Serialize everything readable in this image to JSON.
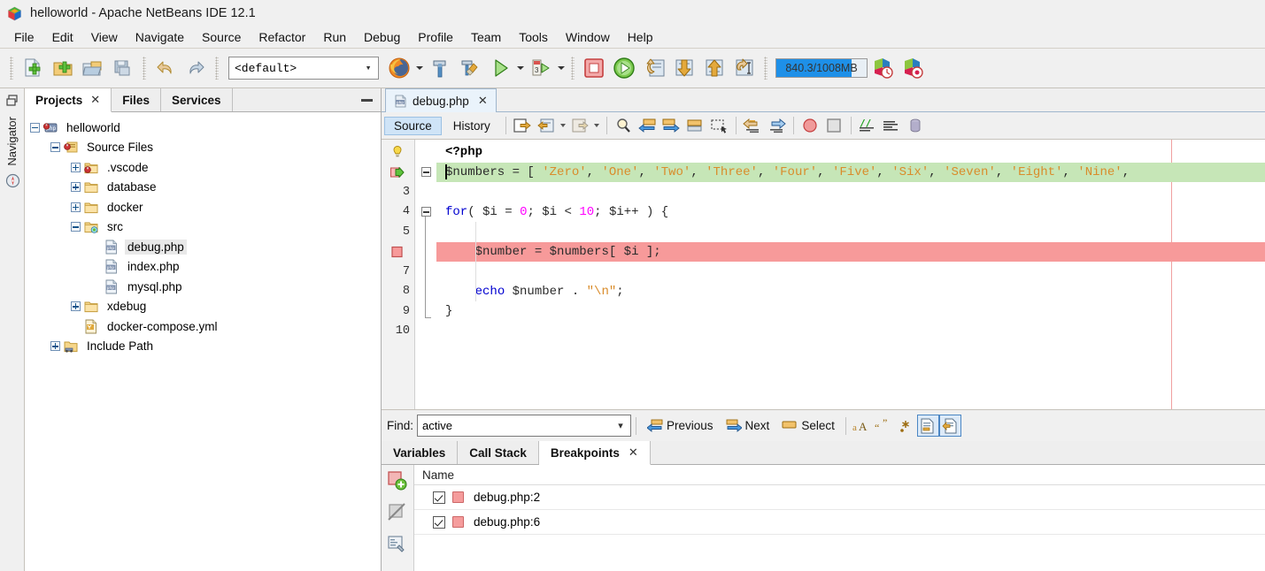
{
  "window": {
    "title": "helloworld - Apache NetBeans IDE 12.1",
    "logo_icon": "netbeans-logo-icon"
  },
  "menubar": {
    "items": [
      {
        "label": "File"
      },
      {
        "label": "Edit"
      },
      {
        "label": "View"
      },
      {
        "label": "Navigate"
      },
      {
        "label": "Source"
      },
      {
        "label": "Refactor"
      },
      {
        "label": "Run"
      },
      {
        "label": "Debug"
      },
      {
        "label": "Profile"
      },
      {
        "label": "Team"
      },
      {
        "label": "Tools"
      },
      {
        "label": "Window"
      },
      {
        "label": "Help"
      }
    ]
  },
  "toolbar": {
    "buttons": [
      {
        "name": "new-file-button",
        "icon": "new-file-icon"
      },
      {
        "name": "new-project-button",
        "icon": "new-project-icon"
      },
      {
        "name": "open-project-button",
        "icon": "open-project-icon"
      },
      {
        "name": "save-all-button",
        "icon": "save-all-icon"
      },
      {
        "name": "undo-button",
        "icon": "undo-icon"
      },
      {
        "name": "redo-button",
        "icon": "redo-icon"
      }
    ],
    "config_combo": {
      "value": "<default>",
      "arrow_icon": "chevron-down-icon"
    },
    "browser_button": {
      "name": "browser-button",
      "icon": "firefox-icon"
    },
    "build_button": {
      "name": "build-project-button",
      "icon": "hammer-icon"
    },
    "clean_build_button": {
      "name": "clean-build-button",
      "icon": "hammer-broom-icon"
    },
    "run_button": {
      "name": "run-project-button",
      "icon": "play-green-icon"
    },
    "debug_button": {
      "name": "debug-project-button",
      "icon": "debug-icon"
    },
    "stop_button": {
      "name": "stop-session-button",
      "icon": "stop-red-icon"
    },
    "continue_button": {
      "name": "continue-button",
      "icon": "continue-green-icon"
    },
    "step_over_button": {
      "name": "step-over-button",
      "icon": "step-over-icon"
    },
    "step_into_button": {
      "name": "step-into-button",
      "icon": "step-into-icon"
    },
    "step_out_button": {
      "name": "step-out-button",
      "icon": "step-out-icon"
    },
    "run_to_cursor_button": {
      "name": "run-to-cursor-button",
      "icon": "run-to-cursor-icon"
    },
    "memory": {
      "label": "840.3/1008MB",
      "used_mb": 840.3,
      "total_mb": 1008,
      "percent": 83.4,
      "bar_color": "#1e90e8"
    },
    "profile_buttons": [
      {
        "name": "profile-time-button",
        "icon": "profile-clock-icon"
      },
      {
        "name": "profile-memory-button",
        "icon": "profile-record-icon"
      }
    ]
  },
  "left_strip": {
    "window_icon": "windows-cascade-icon",
    "navigator_label": "Navigator",
    "navigator_icon": "compass-icon"
  },
  "projects_panel": {
    "tabs": [
      {
        "label": "Projects",
        "active": true,
        "closable": true
      },
      {
        "label": "Files",
        "active": false,
        "closable": false
      },
      {
        "label": "Services",
        "active": false,
        "closable": false
      }
    ],
    "minimize_icon": "minimize-icon",
    "tree": [
      {
        "label": "helloworld",
        "indent": 0,
        "expander": "minus",
        "icon": "php-project-icon",
        "selected": false
      },
      {
        "label": "Source Files",
        "indent": 1,
        "expander": "minus",
        "icon": "source-files-icon",
        "selected": false
      },
      {
        "label": ".vscode",
        "indent": 2,
        "expander": "plus",
        "icon": "folder-badge-icon",
        "selected": false
      },
      {
        "label": "database",
        "indent": 2,
        "expander": "plus",
        "icon": "folder-icon",
        "selected": false
      },
      {
        "label": "docker",
        "indent": 2,
        "expander": "plus",
        "icon": "folder-icon",
        "selected": false
      },
      {
        "label": "src",
        "indent": 2,
        "expander": "minus",
        "icon": "folder-src-icon",
        "selected": false
      },
      {
        "label": "debug.php",
        "indent": 3,
        "expander": "none",
        "icon": "php-file-icon",
        "selected": true
      },
      {
        "label": "index.php",
        "indent": 3,
        "expander": "none",
        "icon": "php-file-icon",
        "selected": false
      },
      {
        "label": "mysql.php",
        "indent": 3,
        "expander": "none",
        "icon": "php-file-icon",
        "selected": false
      },
      {
        "label": "xdebug",
        "indent": 2,
        "expander": "plus",
        "icon": "folder-icon",
        "selected": false
      },
      {
        "label": "docker-compose.yml",
        "indent": 2,
        "expander": "none",
        "icon": "yml-file-icon",
        "selected": false
      },
      {
        "label": "Include Path",
        "indent": 1,
        "expander": "plus",
        "icon": "include-path-icon",
        "selected": false
      }
    ]
  },
  "editor": {
    "tab": {
      "label": "debug.php",
      "icon": "php-file-icon",
      "close_icon": "close-icon"
    },
    "view_buttons": [
      {
        "label": "Source",
        "active": true
      },
      {
        "label": "History",
        "active": false
      }
    ],
    "toolbar_icons": [
      "last-edit-icon",
      "back-icon",
      "forward-icon",
      "find-selection-icon",
      "previous-bookmark-icon",
      "next-bookmark-icon",
      "toggle-bookmark-icon",
      "toggle-rectangular-selection-icon",
      "shift-line-left-icon",
      "shift-line-right-icon",
      "start-macro-recording-icon",
      "stop-macro-recording-icon",
      "comment-icon",
      "uncomment-icon",
      "toggle-highlight-icon",
      "toggle-breakpoint-icon",
      "new-watch-icon",
      "evaluate-expression-icon"
    ],
    "lines": [
      {
        "num": "",
        "gutter_icon": "lightbulb-icon",
        "fold": "none",
        "highlight": "none",
        "tokens": [
          {
            "t": "<?php",
            "c": "k-tag"
          }
        ]
      },
      {
        "num": "",
        "gutter_icon": "current-line-icon",
        "fold": "minus",
        "highlight": "green",
        "tokens": [
          {
            "t": "$numbers",
            "c": "k-var"
          },
          {
            "t": " = [ ",
            "c": "k-op"
          },
          {
            "t": "'Zero'",
            "c": "k-str"
          },
          {
            "t": ", ",
            "c": "k-op"
          },
          {
            "t": "'One'",
            "c": "k-str"
          },
          {
            "t": ", ",
            "c": "k-op"
          },
          {
            "t": "'Two'",
            "c": "k-str"
          },
          {
            "t": ", ",
            "c": "k-op"
          },
          {
            "t": "'Three'",
            "c": "k-str"
          },
          {
            "t": ", ",
            "c": "k-op"
          },
          {
            "t": "'Four'",
            "c": "k-str"
          },
          {
            "t": ", ",
            "c": "k-op"
          },
          {
            "t": "'Five'",
            "c": "k-str"
          },
          {
            "t": ", ",
            "c": "k-op"
          },
          {
            "t": "'Six'",
            "c": "k-str"
          },
          {
            "t": ", ",
            "c": "k-op"
          },
          {
            "t": "'Seven'",
            "c": "k-str"
          },
          {
            "t": ", ",
            "c": "k-op"
          },
          {
            "t": "'Eight'",
            "c": "k-str"
          },
          {
            "t": ", ",
            "c": "k-op"
          },
          {
            "t": "'Nine'",
            "c": "k-str"
          },
          {
            "t": ",",
            "c": "k-op"
          }
        ]
      },
      {
        "num": "3",
        "gutter_icon": "none",
        "fold": "none",
        "highlight": "none",
        "tokens": []
      },
      {
        "num": "4",
        "gutter_icon": "none",
        "fold": "minus",
        "highlight": "none",
        "tokens": [
          {
            "t": "for",
            "c": "k-kw"
          },
          {
            "t": "( ",
            "c": "k-op"
          },
          {
            "t": "$i",
            "c": "k-var"
          },
          {
            "t": " = ",
            "c": "k-op"
          },
          {
            "t": "0",
            "c": "k-num"
          },
          {
            "t": "; ",
            "c": "k-op"
          },
          {
            "t": "$i",
            "c": "k-var"
          },
          {
            "t": " < ",
            "c": "k-op"
          },
          {
            "t": "10",
            "c": "k-num"
          },
          {
            "t": "; ",
            "c": "k-op"
          },
          {
            "t": "$i++",
            "c": "k-var"
          },
          {
            "t": " ) {",
            "c": "k-op"
          }
        ]
      },
      {
        "num": "5",
        "gutter_icon": "none",
        "fold": "none",
        "highlight": "none",
        "tokens": []
      },
      {
        "num": "",
        "gutter_icon": "breakpoint-icon",
        "fold": "none",
        "highlight": "red",
        "tokens": [
          {
            "t": "    $number",
            "c": "k-var"
          },
          {
            "t": " = ",
            "c": "k-op"
          },
          {
            "t": "$numbers",
            "c": "k-var"
          },
          {
            "t": "[ ",
            "c": "k-op"
          },
          {
            "t": "$i",
            "c": "k-var"
          },
          {
            "t": " ];",
            "c": "k-op"
          }
        ]
      },
      {
        "num": "7",
        "gutter_icon": "none",
        "fold": "none",
        "highlight": "none",
        "tokens": []
      },
      {
        "num": "8",
        "gutter_icon": "none",
        "fold": "none",
        "highlight": "none",
        "tokens": [
          {
            "t": "    ",
            "c": "k-op"
          },
          {
            "t": "echo",
            "c": "k-kw"
          },
          {
            "t": " $number",
            "c": "k-var"
          },
          {
            "t": " . ",
            "c": "k-op"
          },
          {
            "t": "\"\\n\"",
            "c": "k-str"
          },
          {
            "t": ";",
            "c": "k-op"
          }
        ]
      },
      {
        "num": "9",
        "gutter_icon": "none",
        "fold": "end",
        "highlight": "none",
        "tokens": [
          {
            "t": "}",
            "c": "k-op"
          }
        ]
      },
      {
        "num": "10",
        "gutter_icon": "none",
        "fold": "none",
        "highlight": "none",
        "tokens": []
      }
    ],
    "margin_color": "#f0a0a0"
  },
  "findbar": {
    "label": "Find:",
    "value": "active",
    "placeholder": "",
    "dropdown_icon": "chevron-down-icon",
    "previous": {
      "label": "Previous",
      "icon": "previous-match-icon"
    },
    "next": {
      "label": "Next",
      "icon": "next-match-icon"
    },
    "select": {
      "label": "Select",
      "icon": "select-matches-icon"
    },
    "options": [
      {
        "name": "match-case-toggle",
        "icon": "match-case-icon",
        "selected": false
      },
      {
        "name": "whole-words-toggle",
        "icon": "whole-words-icon",
        "selected": false
      },
      {
        "name": "regular-expression-toggle",
        "icon": "regex-icon",
        "selected": false
      },
      {
        "name": "highlight-results-toggle",
        "icon": "highlight-results-icon",
        "selected": true
      },
      {
        "name": "preserve-case-toggle",
        "icon": "preserve-case-icon",
        "selected": true
      }
    ]
  },
  "debug_panel": {
    "tabs": [
      {
        "label": "Variables",
        "active": false,
        "closable": false
      },
      {
        "label": "Call Stack",
        "active": false,
        "closable": false
      },
      {
        "label": "Breakpoints",
        "active": true,
        "closable": true
      }
    ],
    "side_buttons": [
      {
        "name": "new-breakpoint-button",
        "icon": "new-breakpoint-icon"
      },
      {
        "name": "disable-all-breakpoints-button",
        "icon": "disable-breakpoints-icon"
      },
      {
        "name": "breakpoint-properties-button",
        "icon": "breakpoint-properties-icon"
      }
    ],
    "column_header": "Name",
    "rows": [
      {
        "label": "debug.php:2",
        "checked": true,
        "marker": "breakpoint-square-icon"
      },
      {
        "label": "debug.php:6",
        "checked": true,
        "marker": "breakpoint-square-icon"
      }
    ]
  }
}
